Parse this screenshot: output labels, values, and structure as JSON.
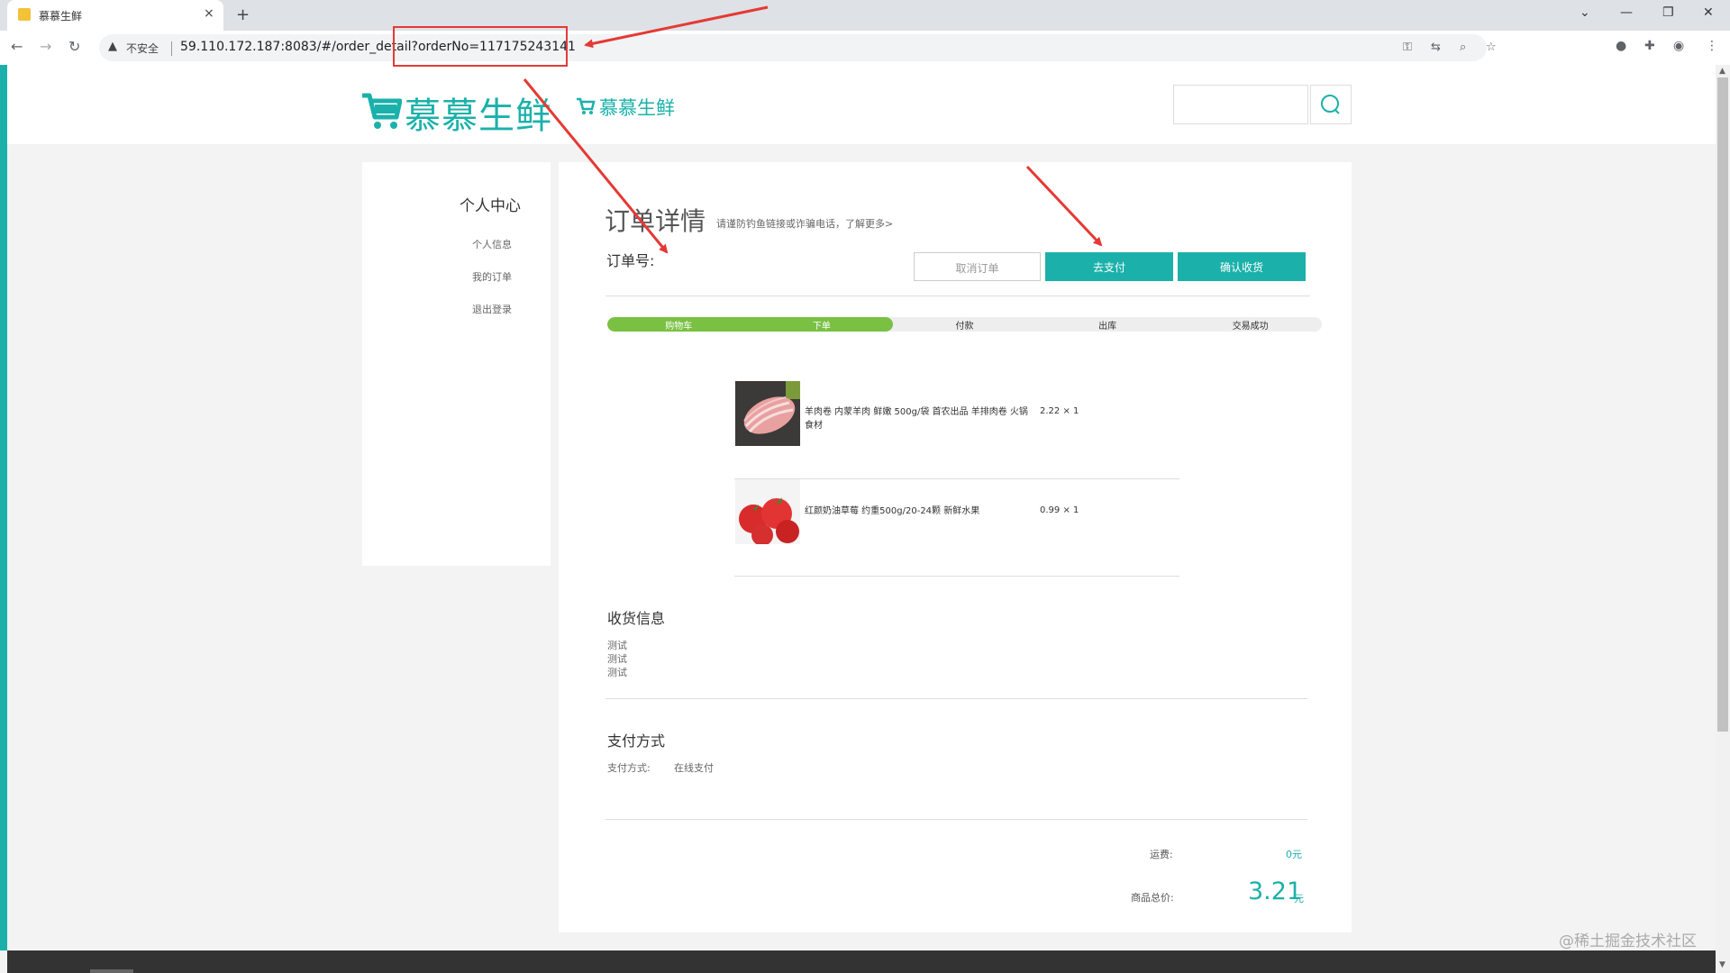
{
  "browser": {
    "tab_title": "慕慕生鲜",
    "tab_close": "×",
    "new_tab": "+",
    "insecure_label": "不安全",
    "url": "59.110.172.187:8083/#/order_detail?orderNo=117175243141"
  },
  "header": {
    "logo_text": "慕慕生鲜",
    "logo_small_text": "慕慕生鲜",
    "search_placeholder": ""
  },
  "sidebar": {
    "title": "个人中心",
    "items": [
      {
        "label": "个人信息"
      },
      {
        "label": "我的订单"
      },
      {
        "label": "退出登录"
      }
    ]
  },
  "order": {
    "title": "订单详情",
    "note": "请谨防钓鱼链接或诈骗电话，了解更多>",
    "order_no_label": "订单号:",
    "buttons": {
      "cancel": "取消订单",
      "pay": "去支付",
      "confirm": "确认收货"
    },
    "progress": {
      "steps": [
        "购物车",
        "下单",
        "付款",
        "出库",
        "交易成功"
      ],
      "completed_steps": 2
    },
    "products": [
      {
        "name": "羊肉卷 内蒙羊肉 鲜嫩 500g/袋 首农出品 羊排肉卷 火锅食材",
        "price": "2.22 × 1"
      },
      {
        "name": "红颜奶油草莓 约重500g/20-24颗 新鲜水果",
        "price": "0.99 × 1"
      }
    ],
    "shipping": {
      "title": "收货信息",
      "lines": [
        "测试",
        "测试",
        "测试"
      ]
    },
    "payment": {
      "title": "支付方式",
      "label": "支付方式:",
      "value": "在线支付"
    },
    "totals": {
      "shipping_label": "运费:",
      "shipping_value": "0元",
      "total_label": "商品总价:",
      "total_value": "3.21",
      "total_unit": "元"
    }
  },
  "watermark": "@稀土掘金技术社区",
  "colors": {
    "brand": "#1bb1aa",
    "progress": "#7ac143",
    "annotation": "#e53935"
  }
}
